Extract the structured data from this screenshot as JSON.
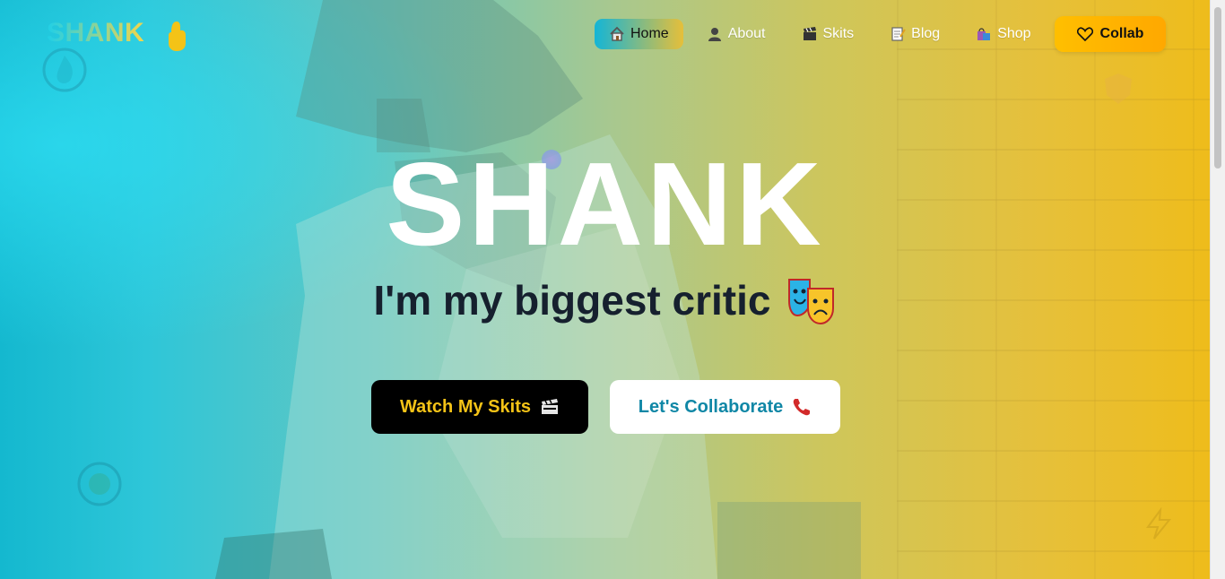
{
  "brand": {
    "name": "SHANK",
    "logo_emoji": "hand-icon"
  },
  "nav": {
    "items": [
      {
        "label": "Home",
        "icon": "house-icon",
        "active": true
      },
      {
        "label": "About",
        "icon": "person-icon",
        "active": false
      },
      {
        "label": "Skits",
        "icon": "clapper-icon",
        "active": false
      },
      {
        "label": "Blog",
        "icon": "memo-icon",
        "active": false
      },
      {
        "label": "Shop",
        "icon": "shopping-bags-icon",
        "active": false
      }
    ],
    "cta": {
      "label": "Collab",
      "icon": "heart-icon"
    }
  },
  "hero": {
    "title": "SHANK",
    "tagline": "I'm my biggest critic",
    "tagline_icon": "performing-arts-icon",
    "buttons": {
      "watch": {
        "label": "Watch My Skits",
        "icon": "clapper-icon"
      },
      "collab": {
        "label": "Let's Collaborate",
        "icon": "telephone-icon"
      }
    }
  },
  "colors": {
    "gradient_start": "#14b8cf",
    "gradient_end": "#efbc18",
    "title": "#ffffff",
    "tagline": "#16202e",
    "watch_bg": "#000000",
    "watch_text": "#f4c317",
    "collab_text": "#1087a6",
    "cta_bg": "#ffb400"
  }
}
